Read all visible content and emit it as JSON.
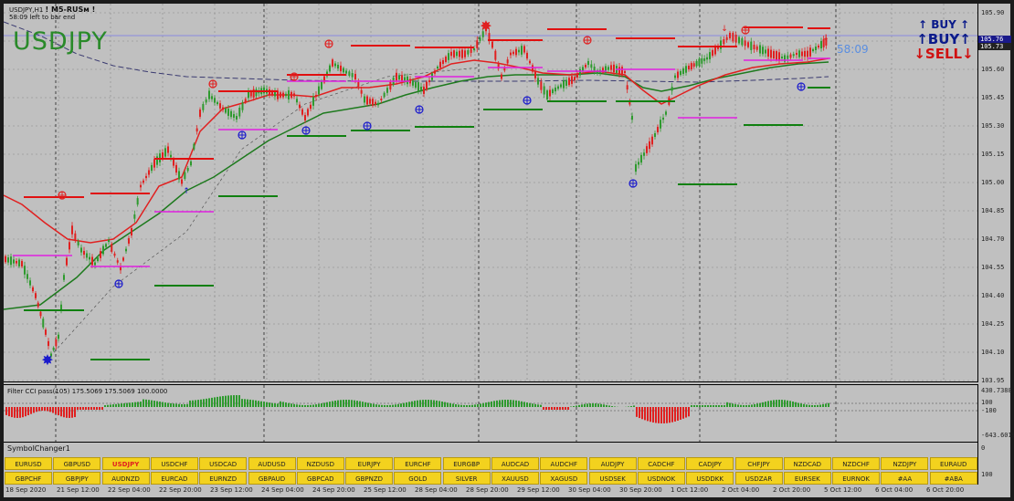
{
  "header": {
    "symbol_timeframe": "USDJPY,H1",
    "ea_name": "! M5-RUSм !",
    "bar_timer": "58:09 left to bar end",
    "big_symbol": "USDJPY",
    "countdown": "58:09"
  },
  "trade_panel": {
    "buy_small": "↑ BUY ↑",
    "buy": "↑BUY↑",
    "sell": "↓SELL↓"
  },
  "price_axis": {
    "ticks": [
      "105.90",
      "105.75",
      "105.60",
      "105.45",
      "105.30",
      "105.15",
      "105.00",
      "104.85",
      "104.70",
      "104.55",
      "104.40",
      "104.25",
      "104.10",
      "103.95"
    ],
    "tag_bid": "105.76",
    "tag_ask": "105.73"
  },
  "indicator": {
    "label": "Filter CCI pass(105)  175.5069 175.5069 100.0000",
    "ticks": [
      "430.7388",
      "100",
      "-100",
      "-643.6019"
    ]
  },
  "symbol_changer": {
    "label": "SymbolChanger1",
    "right_ticks": [
      "0",
      "100"
    ],
    "row1": [
      "EURUSD",
      "GBPUSD",
      "USDJPY",
      "USDCHF",
      "USDCAD",
      "AUDUSD",
      "NZDUSD",
      "EURJPY",
      "EURCHF",
      "EURGBP",
      "AUDCAD",
      "AUDCHF",
      "AUDJPY",
      "CADCHF",
      "CADJPY",
      "CHFJPY",
      "NZDCAD",
      "NZDCHF",
      "NZDJPY",
      "EURAUD"
    ],
    "row2": [
      "GBPCHF",
      "GBPJPY",
      "AUDNZD",
      "EURCAD",
      "EURNZD",
      "GBPAUD",
      "GBPCAD",
      "GBPNZD",
      "GOLD",
      "SILVER",
      "XAUUSD",
      "XAGUSD",
      "USDSEK",
      "USDNOK",
      "USDDKK",
      "USDZAR",
      "EURSEK",
      "EURNOK",
      "#AA",
      "#ABA"
    ],
    "active": "USDJPY"
  },
  "time_axis": {
    "labels": [
      "18 Sep 2020",
      "21 Sep 12:00",
      "22 Sep 04:00",
      "22 Sep 20:00",
      "23 Sep 12:00",
      "24 Sep 04:00",
      "24 Sep 20:00",
      "25 Sep 12:00",
      "28 Sep 04:00",
      "28 Sep 20:00",
      "29 Sep 12:00",
      "30 Sep 04:00",
      "30 Sep 20:00",
      "1 Oct 12:00",
      "2 Oct 04:00",
      "2 Oct 20:00",
      "5 Oct 12:00",
      "6 Oct 04:00",
      "6 Oct 20:00"
    ]
  },
  "colors": {
    "bull": "#2e9a2e",
    "bear": "#e02020",
    "ma_red": "#e02020",
    "ma_green": "#1e7a1e",
    "ma_navy": "#3a3a70",
    "resistance": "#e01010",
    "support": "#108010",
    "pivot": "#e020e0",
    "grid": "#888888",
    "price_line": "#8a8ae0"
  }
}
